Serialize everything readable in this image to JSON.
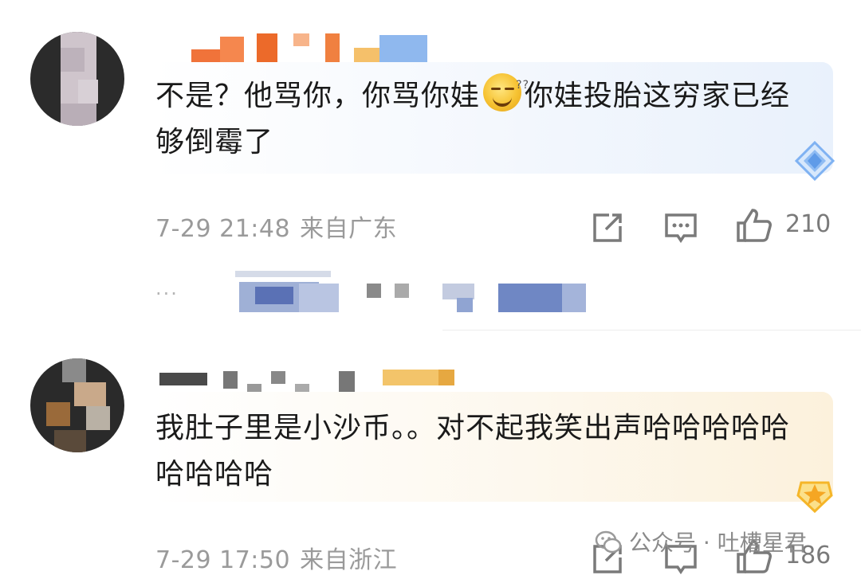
{
  "comments": [
    {
      "text_part1": "不是？他骂你，你骂你娃",
      "emoji": "sleepy-smile-emoji-icon",
      "text_part2": "你娃投胎这穷家已经够倒霉了",
      "time": "7-29 21:48",
      "location": "来自广东",
      "likes": "210",
      "badge_color": "#6fa8f0"
    },
    {
      "text": "我肚子里是小沙币。。对不起我笑出声哈哈哈哈哈哈哈哈哈",
      "time": "7-29 17:50",
      "location": "来自浙江",
      "likes": "186",
      "badge_color": "#f5b629"
    }
  ],
  "reply_preview": {
    "dots": "..."
  },
  "watermark": {
    "text": "公众号 · 吐槽星君"
  },
  "colors": {
    "text": "#1a1a1a",
    "meta": "#9a9a9a",
    "icon": "#8a8a8a"
  }
}
